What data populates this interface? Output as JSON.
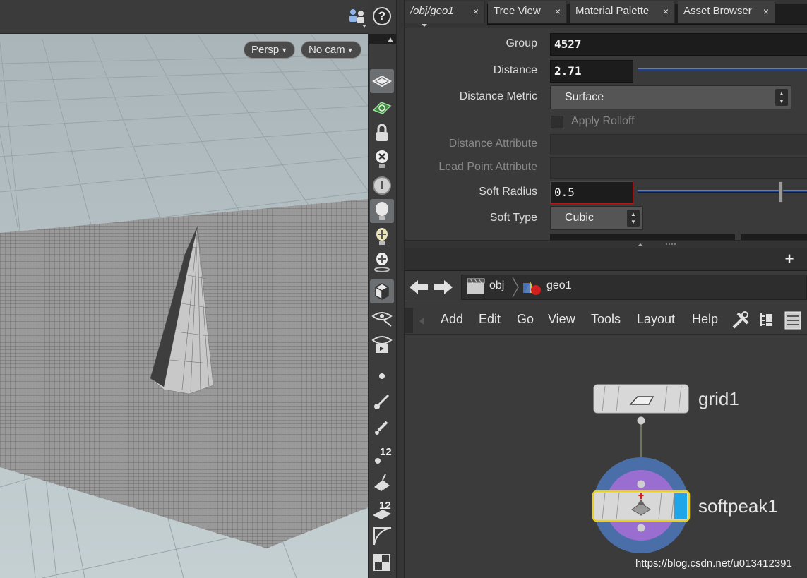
{
  "viewport": {
    "camera_mode": "Persp",
    "camera_name": "No cam",
    "help_glyph": "?"
  },
  "toolstrip": {
    "icons": [
      "select-mode-icon",
      "snapping-icon",
      "lock-icon",
      "hide-icon",
      "display-options-icon",
      "lightbulb-icon",
      "add-light-icon",
      "light-link-icon",
      "shaded-cube-icon",
      "visibility-icon",
      "render-view-icon",
      "point-icon",
      "curve-brush-icon",
      "pen-icon",
      "point-numbers-icon",
      "paint-icon",
      "primitive-numbers-icon",
      "edge-icon",
      "grid-snap-icon"
    ],
    "point_number_label": "12",
    "prim_number_label": "12"
  },
  "params": {
    "node_type": "Soft Peak",
    "node_name": "softpeak1",
    "fields": {
      "group": {
        "label": "Group",
        "value": "4527"
      },
      "distance": {
        "label": "Distance",
        "value": "2.71"
      },
      "distance_metric": {
        "label": "Distance Metric",
        "value": "Surface"
      },
      "apply_rolloff": {
        "label": "Apply Rolloff"
      },
      "distance_attribute": {
        "label": "Distance Attribute"
      },
      "lead_point_attribute": {
        "label": "Lead Point Attribute"
      },
      "soft_radius": {
        "label": "Soft Radius",
        "value": "0.5"
      },
      "soft_type": {
        "label": "Soft Type",
        "value": "Cubic"
      }
    }
  },
  "tabs": [
    {
      "label": "/obj/geo1",
      "active": true
    },
    {
      "label": "Tree View"
    },
    {
      "label": "Material Palette"
    },
    {
      "label": "Asset Browser"
    }
  ],
  "tab_close_glyph": "×",
  "tab_add_glyph": "+",
  "path": {
    "crumbs": [
      "obj",
      "geo1"
    ]
  },
  "network_menu": [
    "Add",
    "Edit",
    "Go",
    "View",
    "Tools",
    "Layout",
    "Help"
  ],
  "nodes": [
    {
      "name": "grid1"
    },
    {
      "name": "softpeak1",
      "selected": true
    }
  ],
  "watermark": "https://blog.csdn.net/u013412391"
}
